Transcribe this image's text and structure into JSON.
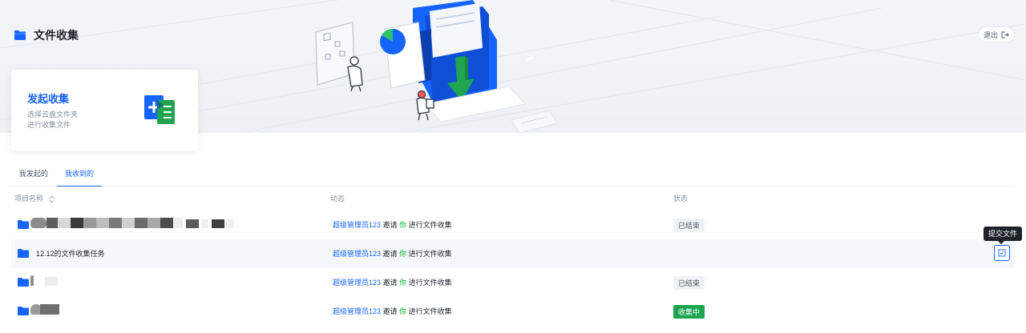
{
  "header": {
    "title": "文件收集",
    "logout_label": "退出"
  },
  "start_card": {
    "title": "发起收集",
    "desc_line1": "选择云盘文件夹",
    "desc_line2": "进行收集文件"
  },
  "tabs": [
    {
      "label": "我发起的",
      "active": false
    },
    {
      "label": "我收到的",
      "active": true
    }
  ],
  "table": {
    "columns": {
      "name": "项目名称",
      "activity": "动态",
      "status": "状态"
    },
    "rows": [
      {
        "name": "",
        "admin": "超级管理员123",
        "invite": "邀请",
        "you": "你",
        "action": "进行文件收集",
        "status": "已结束"
      },
      {
        "name": "12.12的文件收集任务",
        "admin": "超级管理员123",
        "invite": "邀请",
        "you": "你",
        "action": "进行文件收集",
        "status": ""
      },
      {
        "name": "",
        "admin": "超级管理员123",
        "invite": "邀请",
        "you": "你",
        "action": "进行文件收集",
        "status": "已结束"
      },
      {
        "name": "",
        "admin": "超级管理员123",
        "invite": "邀请",
        "you": "你",
        "action": "进行文件收集",
        "status": "收集中"
      }
    ]
  },
  "tooltip": "提交文件",
  "colors": {
    "accent": "#1664ff",
    "success": "#1fa54f",
    "you": "#00b42a"
  }
}
